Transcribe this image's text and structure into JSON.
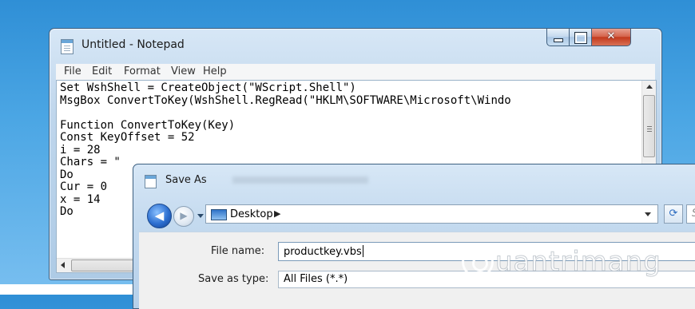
{
  "notepad": {
    "title": "Untitled - Notepad",
    "menu": [
      "File",
      "Edit",
      "Format",
      "View",
      "Help"
    ],
    "code_lines": [
      "Set WshShell = CreateObject(\"WScript.Shell\")",
      "MsgBox ConvertToKey(WshShell.RegRead(\"HKLM\\SOFTWARE\\Microsoft\\Windo",
      "",
      "Function ConvertToKey(Key)",
      "Const KeyOffset = 52",
      "i = 28",
      "Chars = \"",
      "Do",
      "Cur = 0",
      "x = 14",
      "Do"
    ]
  },
  "save_as": {
    "title": "Save As",
    "address": "Desktop",
    "search_placeholder": "Sea",
    "file_name_label": "File name:",
    "file_name_value": "productkey.vbs",
    "save_type_label": "Save as type:",
    "save_type_value": "All Files  (*.*)"
  },
  "watermark": "uantrimang"
}
